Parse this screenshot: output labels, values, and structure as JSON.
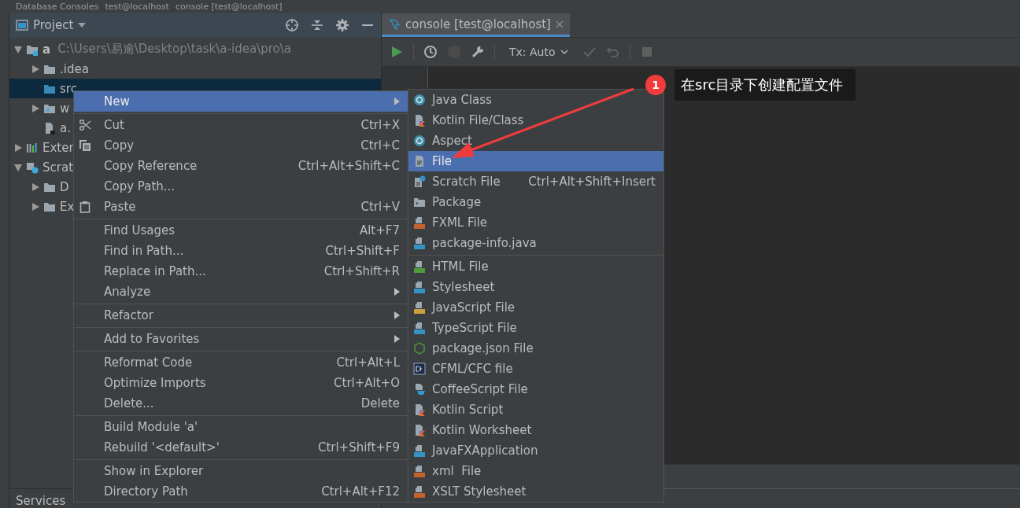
{
  "breadcrumb": [
    "Database Consoles",
    "test@localhost",
    "console [test@localhost]"
  ],
  "project_panel": {
    "title": "Project",
    "tree": [
      {
        "label": "a",
        "path": "C:\\Users\\易逾\\Desktop\\task\\a-idea\\pro\\a",
        "kind": "module",
        "expanded": true,
        "selected": false,
        "children": [
          {
            "label": ".idea",
            "kind": "folder",
            "expanded": false,
            "selected": false
          },
          {
            "label": "src",
            "kind": "source",
            "selected": true
          },
          {
            "label": "w",
            "kind": "web",
            "expanded": false,
            "selected": false
          },
          {
            "label": "a.",
            "kind": "file",
            "selected": false
          }
        ]
      },
      {
        "label": "Exter",
        "kind": "library",
        "expanded": false,
        "selected": false
      },
      {
        "label": "Scrat",
        "kind": "scratches",
        "expanded": true,
        "selected": false,
        "children": [
          {
            "label": "D",
            "kind": "folder",
            "expanded": false,
            "selected": false
          },
          {
            "label": "Ex",
            "kind": "folder",
            "expanded": false,
            "selected": false
          }
        ]
      }
    ]
  },
  "editor_tab": {
    "label": "console [test@localhost]",
    "selected": true
  },
  "toolbar": {
    "tx": "Tx: Auto"
  },
  "bottom_tab": "Services",
  "context_menu": [
    [
      {
        "label": "New",
        "kind": "plain",
        "submenu": true,
        "selected": true
      }
    ],
    [
      {
        "label": "Cut",
        "kind": "cut",
        "shortcut": "Ctrl+X",
        "submenu": false,
        "selected": false
      },
      {
        "label": "Copy",
        "kind": "copy",
        "shortcut": "Ctrl+C",
        "submenu": false,
        "selected": false
      },
      {
        "label": "Copy Reference",
        "kind": "plain",
        "shortcut": "Ctrl+Alt+Shift+C",
        "submenu": false,
        "selected": false
      },
      {
        "label": "Copy Path...",
        "kind": "plain",
        "submenu": false,
        "selected": false
      },
      {
        "label": "Paste",
        "kind": "paste",
        "shortcut": "Ctrl+V",
        "submenu": false,
        "selected": false
      }
    ],
    [
      {
        "label": "Find Usages",
        "kind": "plain",
        "shortcut": "Alt+F7",
        "submenu": false,
        "selected": false
      },
      {
        "label": "Find in Path...",
        "kind": "plain",
        "shortcut": "Ctrl+Shift+F",
        "submenu": false,
        "selected": false
      },
      {
        "label": "Replace in Path...",
        "kind": "plain",
        "shortcut": "Ctrl+Shift+R",
        "submenu": false,
        "selected": false
      },
      {
        "label": "Analyze",
        "kind": "plain",
        "submenu": true,
        "selected": false
      }
    ],
    [
      {
        "label": "Refactor",
        "kind": "plain",
        "submenu": true,
        "selected": false
      }
    ],
    [
      {
        "label": "Add to Favorites",
        "kind": "plain",
        "submenu": true,
        "selected": false
      }
    ],
    [
      {
        "label": "Reformat Code",
        "kind": "plain",
        "shortcut": "Ctrl+Alt+L",
        "submenu": false,
        "selected": false
      },
      {
        "label": "Optimize Imports",
        "kind": "plain",
        "shortcut": "Ctrl+Alt+O",
        "submenu": false,
        "selected": false
      },
      {
        "label": "Delete...",
        "kind": "plain",
        "shortcut": "Delete",
        "submenu": false,
        "selected": false
      }
    ],
    [
      {
        "label": "Build Module 'a'",
        "kind": "plain",
        "submenu": false,
        "selected": false
      },
      {
        "label": "Rebuild '<default>'",
        "kind": "plain",
        "shortcut": "Ctrl+Shift+F9",
        "submenu": false,
        "selected": false
      }
    ],
    [
      {
        "label": "Show in Explorer",
        "kind": "plain",
        "submenu": false,
        "selected": false
      },
      {
        "label": "Directory Path",
        "kind": "plain",
        "shortcut": "Ctrl+Alt+F12",
        "submenu": false,
        "selected": false
      }
    ]
  ],
  "new_submenu": [
    [
      {
        "label": "Java Class",
        "kind": "class",
        "selected": false
      },
      {
        "label": "Kotlin File/Class",
        "kind": "kotlin",
        "selected": false
      },
      {
        "label": "Aspect",
        "kind": "aspect",
        "selected": false
      },
      {
        "label": "File",
        "kind": "text",
        "selected": true
      },
      {
        "label": "Scratch File",
        "kind": "scratch",
        "shortcut": "Ctrl+Alt+Shift+Insert",
        "selected": false
      },
      {
        "label": "Package",
        "kind": "package",
        "selected": false
      },
      {
        "label": "FXML File",
        "kind": "xml",
        "selected": false
      },
      {
        "label": "package-info.java",
        "kind": "java",
        "selected": false
      }
    ],
    [
      {
        "label": "HTML File",
        "kind": "html",
        "selected": false
      },
      {
        "label": "Stylesheet",
        "kind": "css",
        "selected": false
      },
      {
        "label": "JavaScript File",
        "kind": "js",
        "selected": false
      },
      {
        "label": "TypeScript File",
        "kind": "ts",
        "selected": false
      },
      {
        "label": "package.json File",
        "kind": "npm",
        "selected": false
      },
      {
        "label": "CFML/CFC file",
        "kind": "cfml",
        "selected": false
      },
      {
        "label": "CoffeeScript File",
        "kind": "coffee",
        "selected": false
      },
      {
        "label": "Kotlin Script",
        "kind": "kotlin",
        "selected": false
      },
      {
        "label": "Kotlin Worksheet",
        "kind": "kotlin",
        "selected": false
      },
      {
        "label": "JavaFXApplication",
        "kind": "java",
        "selected": false
      },
      {
        "label": "xml  File",
        "kind": "xml",
        "selected": false
      },
      {
        "label": "XSLT Stylesheet",
        "kind": "xml",
        "selected": false
      }
    ]
  ],
  "annotation": {
    "number": "1",
    "text": "在src目录下创建配置文件"
  }
}
